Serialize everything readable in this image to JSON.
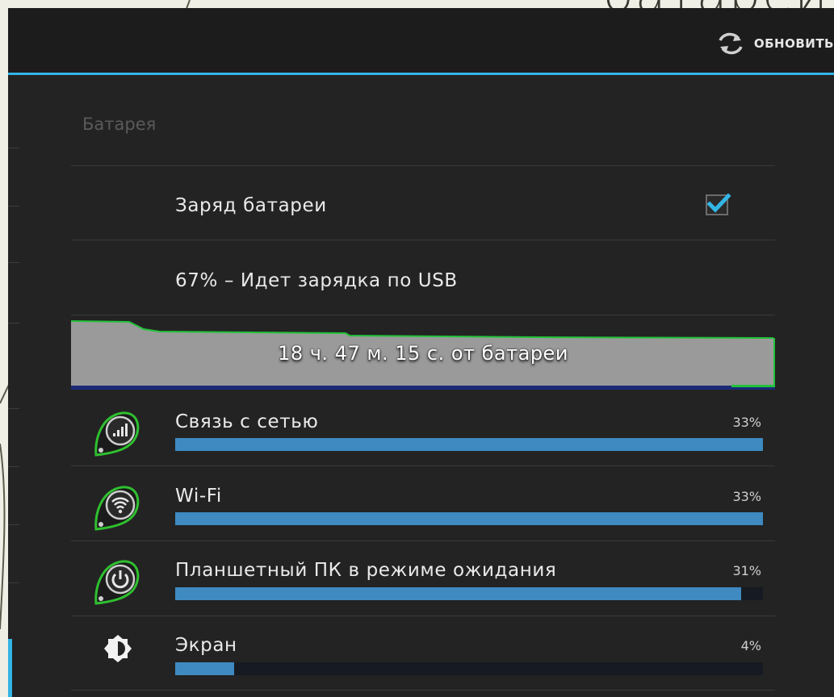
{
  "slide": {
    "title_tail": "батарей"
  },
  "actionbar": {
    "refresh_label": "ОБНОВИТЬ",
    "refresh_icon": "refresh-icon"
  },
  "section": {
    "title": "Батарея"
  },
  "battery_level": {
    "label": "Заряд батареи",
    "checked": true
  },
  "status": {
    "text": "67% – Идет зарядка по USB"
  },
  "graph": {
    "label": "18 ч. 47 м. 15 с. от батареи",
    "line_color": "#22c33a",
    "fill_color": "#9a9a9a"
  },
  "accent_color": "#33b5e5",
  "usage": [
    {
      "name": "Связь с сетью",
      "percent": "33%",
      "fraction": 1.0,
      "icon": "cell-signal-icon"
    },
    {
      "name": "Wi-Fi",
      "percent": "33%",
      "fraction": 1.0,
      "icon": "wifi-icon"
    },
    {
      "name": "Планшетный ПК в режиме ожидания",
      "percent": "31%",
      "fraction": 0.963,
      "icon": "power-icon"
    },
    {
      "name": "Экран",
      "percent": "4%",
      "fraction": 0.1,
      "icon": "brightness-icon"
    }
  ]
}
